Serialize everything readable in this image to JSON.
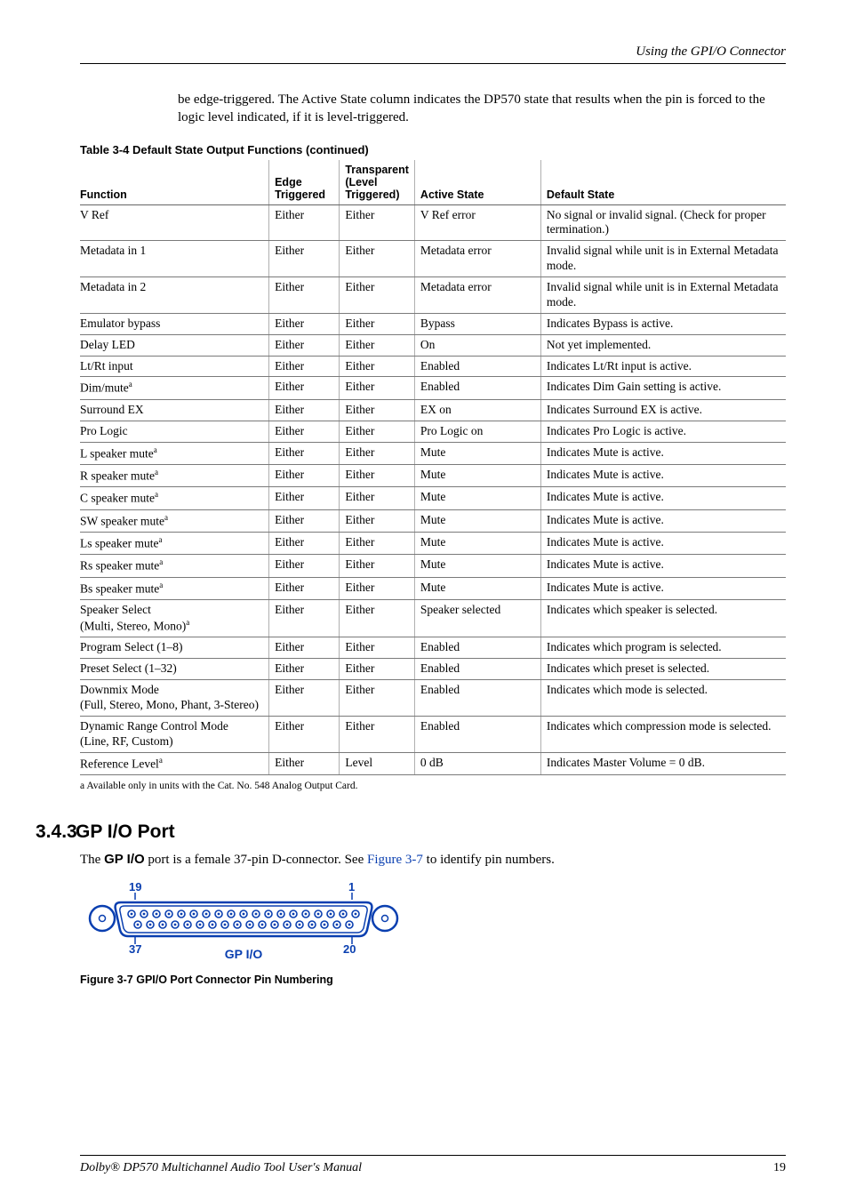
{
  "running_head": "Using the GPI/O Connector",
  "intro_text": "be edge-triggered. The Active State column indicates the DP570 state that results when the pin is forced to the logic level indicated, if it is level-triggered.",
  "table_caption_prefix": "Table 3-4",
  "table_caption_rest": " Default State Output Functions (continued)",
  "headers": {
    "fn": "Function",
    "et": "Edge Triggered",
    "tt": "Transparent (Level Triggered)",
    "as": "Active State",
    "ds": "Default State"
  },
  "rows": [
    {
      "fn": "V Ref",
      "et": "Either",
      "tt": "Either",
      "as": "V Ref error",
      "ds": "No signal or invalid signal. (Check for proper termination.)"
    },
    {
      "fn": "Metadata in 1",
      "et": "Either",
      "tt": "Either",
      "as": "Metadata error",
      "ds": "Invalid signal while unit is in External Metadata mode."
    },
    {
      "fn": "Metadata in 2",
      "et": "Either",
      "tt": "Either",
      "as": "Metadata error",
      "ds": "Invalid signal while unit is in External Metadata mode."
    },
    {
      "fn": "Emulator bypass",
      "et": "Either",
      "tt": "Either",
      "as": "Bypass",
      "ds": "Indicates Bypass is active."
    },
    {
      "fn": "Delay LED",
      "et": "Either",
      "tt": "Either",
      "as": "On",
      "ds": "Not yet implemented."
    },
    {
      "fn": "Lt/Rt input",
      "et": "Either",
      "tt": "Either",
      "as": "Enabled",
      "ds": "Indicates Lt/Rt input is active."
    },
    {
      "fn": "Dim/mute",
      "sup": "a",
      "et": "Either",
      "tt": "Either",
      "as": "Enabled",
      "ds": "Indicates Dim Gain setting is active."
    },
    {
      "fn": "Surround EX",
      "et": "Either",
      "tt": "Either",
      "as": "EX on",
      "ds": "Indicates Surround EX is active."
    },
    {
      "fn": "Pro Logic",
      "et": "Either",
      "tt": "Either",
      "as": "Pro Logic on",
      "ds": "Indicates Pro Logic is active."
    },
    {
      "fn": "L speaker mute",
      "sup": "a",
      "et": "Either",
      "tt": "Either",
      "as": "Mute",
      "ds": "Indicates Mute is active."
    },
    {
      "fn": "R speaker mute",
      "sup": "a",
      "et": "Either",
      "tt": "Either",
      "as": "Mute",
      "ds": "Indicates Mute is active."
    },
    {
      "fn": "C speaker mute",
      "sup": "a",
      "et": "Either",
      "tt": "Either",
      "as": "Mute",
      "ds": "Indicates Mute is active."
    },
    {
      "fn": "SW speaker mute",
      "sup": "a",
      "et": "Either",
      "tt": "Either",
      "as": "Mute",
      "ds": "Indicates Mute is active."
    },
    {
      "fn": "Ls speaker mute",
      "sup": "a",
      "et": "Either",
      "tt": "Either",
      "as": "Mute",
      "ds": "Indicates Mute is active."
    },
    {
      "fn": "Rs speaker mute",
      "sup": "a",
      "et": "Either",
      "tt": "Either",
      "as": "Mute",
      "ds": "Indicates Mute is active."
    },
    {
      "fn": "Bs speaker mute",
      "sup": "a",
      "et": "Either",
      "tt": "Either",
      "as": "Mute",
      "ds": "Indicates Mute is active."
    },
    {
      "fn": "Speaker Select\n(Multi, Stereo, Mono)",
      "sup": "a",
      "et": "Either",
      "tt": "Either",
      "as": "Speaker selected",
      "ds": "Indicates which speaker is selected."
    },
    {
      "fn": "Program Select (1–8)",
      "et": "Either",
      "tt": "Either",
      "as": "Enabled",
      "ds": "Indicates which program is selected."
    },
    {
      "fn": "Preset Select (1–32)",
      "et": "Either",
      "tt": "Either",
      "as": "Enabled",
      "ds": "Indicates which preset is selected."
    },
    {
      "fn": "Downmix Mode\n(Full, Stereo, Mono, Phant, 3-Stereo)",
      "et": "Either",
      "tt": "Either",
      "as": "Enabled",
      "ds": "Indicates which mode is selected."
    },
    {
      "fn": "Dynamic Range Control Mode\n(Line, RF, Custom)",
      "et": "Either",
      "tt": "Either",
      "as": "Enabled",
      "ds": "Indicates which compression mode is selected."
    },
    {
      "fn": "Reference Level",
      "sup": "a",
      "et": "Either",
      "tt": "Level",
      "as": "0 dB",
      "ds": "Indicates Master Volume = 0 dB."
    }
  ],
  "footnote": "a   Available only in units with the Cat. No. 548 Analog Output Card.",
  "section_num": "3.4.3",
  "section_title": "GP I/O Port",
  "port_sentence_pre": "The ",
  "port_sentence_bold": "GP I/O",
  "port_sentence_mid": " port is a female 37-pin D-connector. See ",
  "port_sentence_link": "Figure 3-7",
  "port_sentence_post": " to identify pin numbers.",
  "conn_labels": {
    "p19": "19",
    "p1": "1",
    "p37": "37",
    "p20": "20",
    "name": "GP I/O"
  },
  "fig_caption_prefix": "Figure 3-7",
  "fig_caption_rest": " GPI/O Port Connector Pin Numbering",
  "footer_left": "Dolby® DP570 Multichannel Audio Tool User's Manual",
  "footer_right": "19"
}
